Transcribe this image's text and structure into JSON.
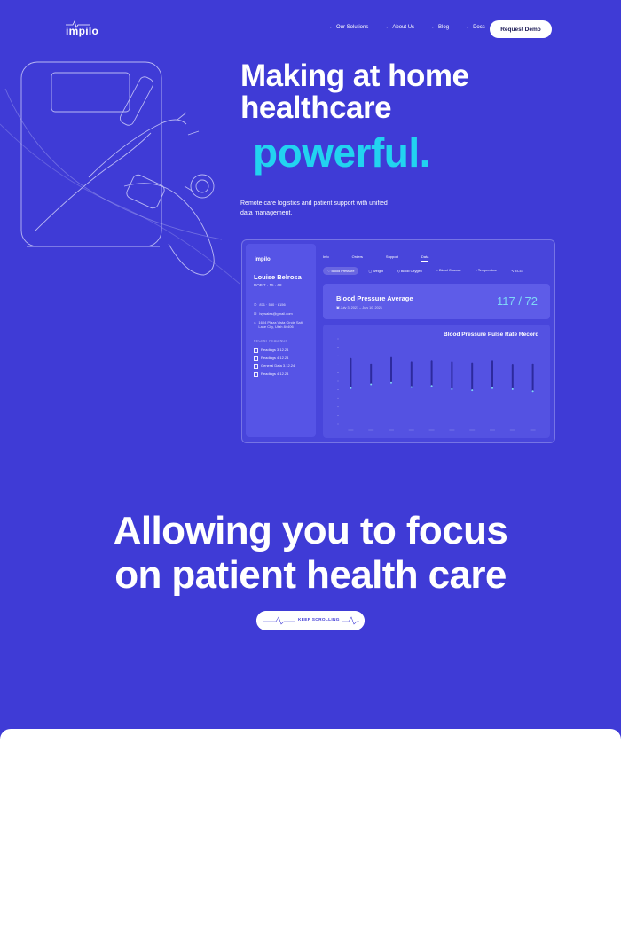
{
  "nav": {
    "logo": "impilo",
    "items": [
      {
        "label": "Our Solutions"
      },
      {
        "label": "About Us"
      },
      {
        "label": "Blog"
      },
      {
        "label": "Docs"
      }
    ],
    "cta": "Request Demo"
  },
  "hero": {
    "title_line1": "Making at home",
    "title_line2": "healthcare",
    "accent": "powerful.",
    "subtitle": "Remote care logistics and patient support with unified data management."
  },
  "dashboard": {
    "logo": "impilo",
    "patient": {
      "name": "Louise Belrosa",
      "dob": "DOB 7 · 15 · 68",
      "phone": "871 · 550 · 8156",
      "email": "lsywales@gmail.com",
      "address": "1604 Plaza Vista Circle Salt Lake City, Utah 84406",
      "section": "RECENT READINGS",
      "readings": [
        "Readings 3.12.24",
        "Readings 4.12.24",
        "General Data 3.12.24",
        "Readings 4.12.24"
      ]
    },
    "tabs": [
      {
        "label": "Info",
        "active": false
      },
      {
        "label": "Orders",
        "active": false
      },
      {
        "label": "Support",
        "active": false
      },
      {
        "label": "Data",
        "active": true
      }
    ],
    "chips": [
      {
        "label": "Blood Pressure",
        "active": true
      },
      {
        "label": "Weight",
        "active": false
      },
      {
        "label": "Blood Oxygen",
        "active": false
      },
      {
        "label": "Blood Glucose",
        "active": false
      },
      {
        "label": "Temperature",
        "active": false
      },
      {
        "label": "ECG",
        "active": false
      }
    ],
    "average": {
      "title": "Blood Pressure Average",
      "date_range": "July 3, 2021 – July 10, 2021",
      "value": "117 / 72"
    },
    "accent_color": "#7fd7f6"
  },
  "chart_data": {
    "type": "bar",
    "title": "Blood Pressure Pulse Rate Record",
    "xlabel": "",
    "ylabel": "",
    "categories": [
      "",
      "",
      "",
      "",
      "",
      "",
      "",
      "",
      "",
      ""
    ],
    "series": [
      {
        "values": [
          [
            68,
            122
          ],
          [
            75,
            112
          ],
          [
            78,
            124
          ],
          [
            70,
            116
          ],
          [
            72,
            118
          ],
          [
            66,
            116
          ],
          [
            64,
            114
          ],
          [
            68,
            118
          ],
          [
            66,
            110
          ],
          [
            62,
            112
          ]
        ]
      }
    ],
    "ylim": [
      0,
      160
    ]
  },
  "section2": {
    "title_line1": "Allowing you to focus",
    "title_line2": "on patient health care",
    "scroll_label": "KEEP SCROLLING"
  }
}
